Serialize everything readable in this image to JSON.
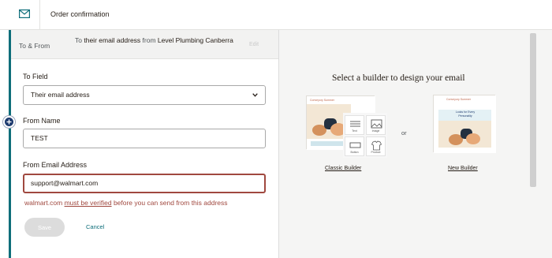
{
  "header": {
    "title": "Order confirmation",
    "icon": "envelope-icon"
  },
  "to_from": {
    "label": "To & From",
    "to_word": "To",
    "recipient": "their email address",
    "from_word": "from",
    "sender": "Level Plumbing Canberra",
    "edit_label": "Edit"
  },
  "form": {
    "to_field": {
      "label": "To Field",
      "value": "Their email address"
    },
    "from_name": {
      "label": "From Name",
      "value": "TEST"
    },
    "from_email": {
      "label": "From Email Address",
      "value": "support@walmart.com"
    },
    "error": {
      "domain": "walmart.com",
      "link": "must be verified",
      "rest": "before you can send from this address"
    },
    "save_label": "Save",
    "cancel_label": "Cancel"
  },
  "builders": {
    "title": "Select a builder to design your email",
    "separator": "or",
    "classic": {
      "label": "Classic Builder",
      "preview_heading": "Conveyory Summer",
      "blocks": [
        "Text",
        "Image",
        "Button",
        "Product"
      ]
    },
    "new": {
      "label": "New Builder",
      "preview_heading": "Conveyory Summer",
      "banner": "Looks for Every Personality"
    }
  },
  "colors": {
    "accent": "#0e6e7a",
    "error": "#a0483f",
    "fab": "#1d3a6e"
  }
}
